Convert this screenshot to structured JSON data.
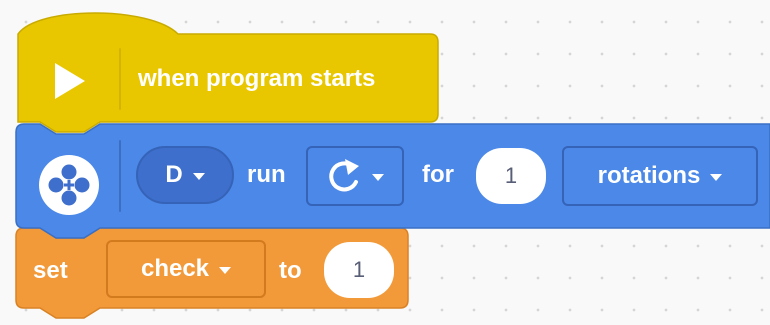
{
  "colors": {
    "events_fill": "#e8c700",
    "events_stroke": "#c9ab00",
    "motor_fill": "#4b88e8",
    "motor_stroke": "#3a6fc4",
    "motor_field": "#3e6fcc",
    "variable_fill": "#f29a3a",
    "variable_stroke": "#d98224",
    "number_text": "#575e75"
  },
  "blocks": {
    "start": {
      "icon": "play-icon",
      "label": "when program starts"
    },
    "motor": {
      "icon": "motor-icon",
      "port": "D",
      "run_label": "run",
      "direction_icon": "clockwise-arrow-icon",
      "for_label": "for",
      "amount": "1",
      "unit": "rotations"
    },
    "variable": {
      "set_label": "set",
      "variable_name": "check",
      "to_label": "to",
      "value": "1"
    }
  }
}
